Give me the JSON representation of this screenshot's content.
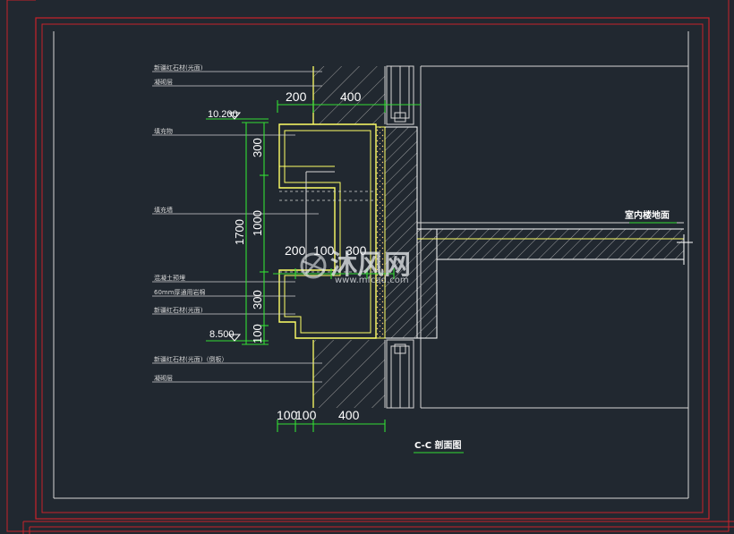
{
  "title": "C-C 剖面图",
  "room_label": "室内楼地面",
  "elevations": {
    "top": "10.200",
    "bottom": "8.500"
  },
  "dims_top": [
    "200",
    "400"
  ],
  "dims_vertical": [
    "300",
    "1000",
    "300",
    "100"
  ],
  "dim_total": "1700",
  "dims_middle": [
    "200",
    "100",
    "300"
  ],
  "dims_bottom": [
    "100",
    "100",
    "400"
  ],
  "notes": [
    "新疆红石材(光面)",
    "凝砌层",
    "填充物",
    "填充墙",
    "混凝土预埋",
    "60mm厚通用岩棉",
    "新疆红石材(光面)",
    "新疆红石材(光面)（倒板）",
    "凝砌层"
  ],
  "watermark": {
    "brand": "沐风网",
    "url": "www.mfcad.com"
  },
  "colors": {
    "background": "#212830",
    "frame": "#c8222a",
    "outline": "#ffff66",
    "dimension": "#33dd33",
    "text": "#ffffff"
  }
}
